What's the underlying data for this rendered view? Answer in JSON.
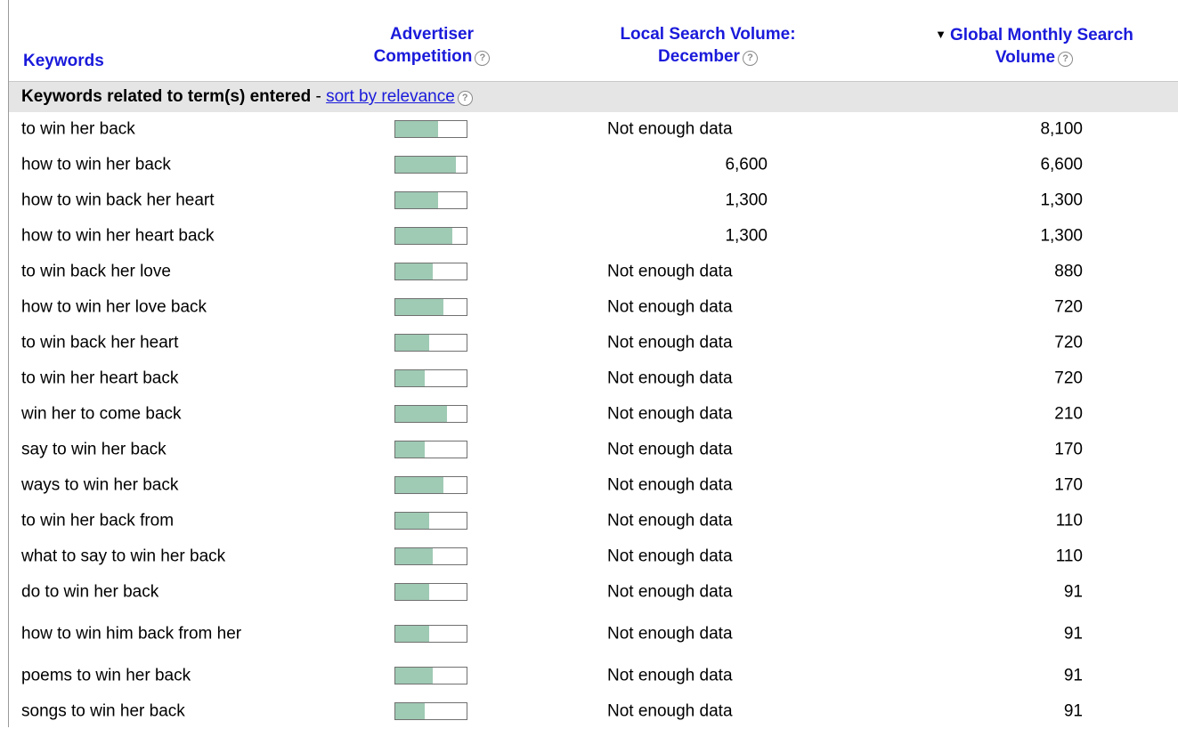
{
  "header": {
    "keywords": "Keywords",
    "competition_line1": "Advertiser",
    "competition_line2": "Competition",
    "local_line1": "Local Search Volume:",
    "local_line2": "December",
    "global_line1": "Global Monthly Search",
    "global_line2": "Volume",
    "sort_indicator": "▼",
    "help_glyph": "?"
  },
  "group": {
    "label": "Keywords related to term(s) entered",
    "separator": " - ",
    "sort_link": "sort by relevance"
  },
  "colors": {
    "link": "#1a1adb",
    "bar_fill": "#9fcab4",
    "group_bg": "#e5e5e5"
  },
  "rows": [
    {
      "keyword": "to win her back",
      "competition": 0.6,
      "local": "Not enough data",
      "global": "8,100"
    },
    {
      "keyword": "how to win her back",
      "competition": 0.85,
      "local": "6,600",
      "global": "6,600"
    },
    {
      "keyword": "how to win back her heart",
      "competition": 0.6,
      "local": "1,300",
      "global": "1,300"
    },
    {
      "keyword": "how to win her heart back",
      "competition": 0.8,
      "local": "1,300",
      "global": "1,300"
    },
    {
      "keyword": "to win back her love",
      "competition": 0.53,
      "local": "Not enough data",
      "global": "880"
    },
    {
      "keyword": "how to win her love back",
      "competition": 0.67,
      "local": "Not enough data",
      "global": "720"
    },
    {
      "keyword": "to win back her heart",
      "competition": 0.48,
      "local": "Not enough data",
      "global": "720"
    },
    {
      "keyword": "to win her heart back",
      "competition": 0.41,
      "local": "Not enough data",
      "global": "720"
    },
    {
      "keyword": "win her to come back",
      "competition": 0.73,
      "local": "Not enough data",
      "global": "210"
    },
    {
      "keyword": "say to win her back",
      "competition": 0.41,
      "local": "Not enough data",
      "global": "170"
    },
    {
      "keyword": "ways to win her back",
      "competition": 0.67,
      "local": "Not enough data",
      "global": "170"
    },
    {
      "keyword": "to win her back from",
      "competition": 0.48,
      "local": "Not enough data",
      "global": "110"
    },
    {
      "keyword": "what to say to win her back",
      "competition": 0.53,
      "local": "Not enough data",
      "global": "110"
    },
    {
      "keyword": "do to win her back",
      "competition": 0.48,
      "local": "Not enough data",
      "global": "91"
    },
    {
      "keyword": "how to win him back from her",
      "competition": 0.48,
      "local": "Not enough data",
      "global": "91"
    },
    {
      "keyword": "poems to win her back",
      "competition": 0.53,
      "local": "Not enough data",
      "global": "91"
    },
    {
      "keyword": "songs to win her back",
      "competition": 0.41,
      "local": "Not enough data",
      "global": "91"
    }
  ]
}
